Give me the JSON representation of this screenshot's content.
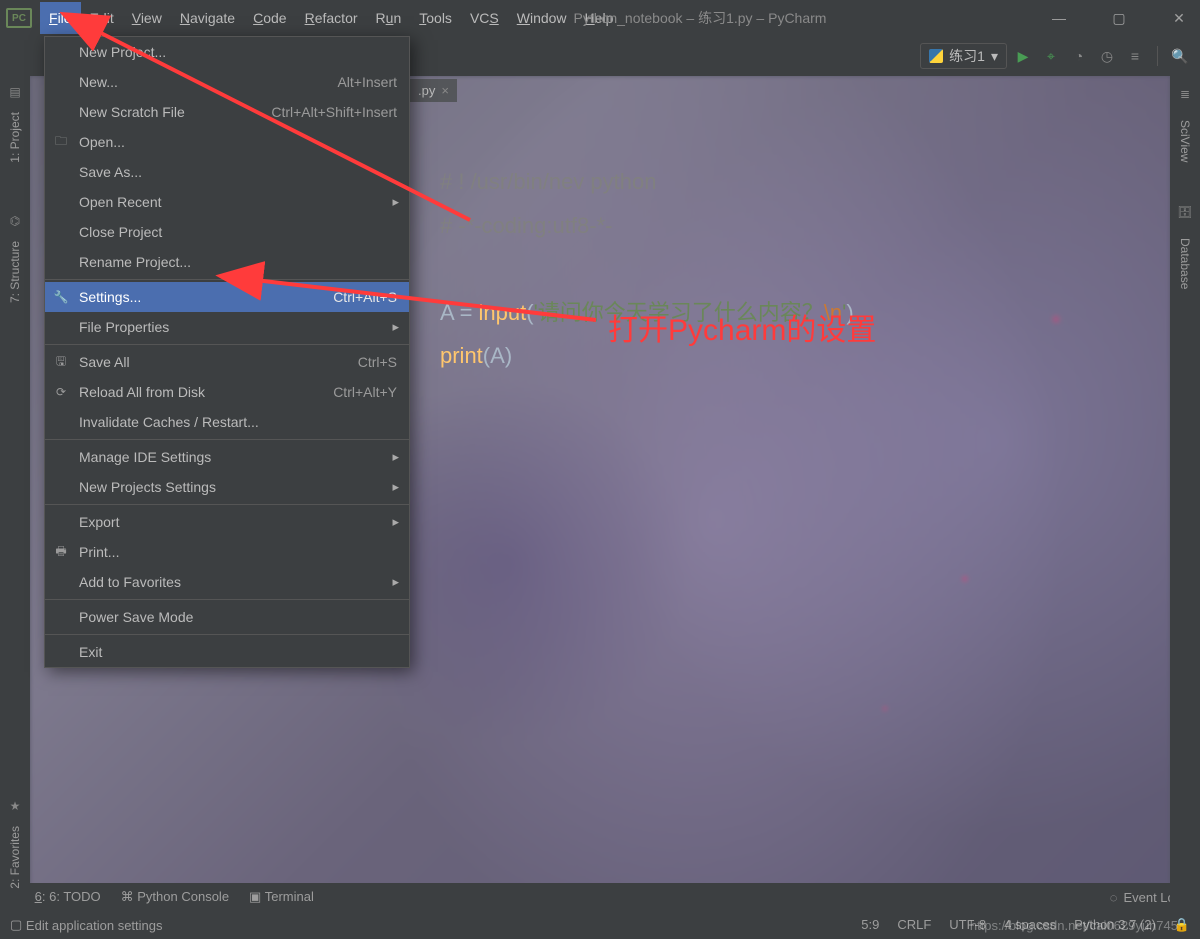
{
  "title": "Python_notebook – 练习1.py – PyCharm",
  "menubar": [
    "File",
    "Edit",
    "View",
    "Navigate",
    "Code",
    "Refactor",
    "Run",
    "Tools",
    "VCS",
    "Window",
    "Help"
  ],
  "window_controls": {
    "min": "—",
    "max": "▢",
    "close": "✕"
  },
  "toolbar": {
    "run_config_label": "练习1",
    "run_config_caret": "▾"
  },
  "left_tools": {
    "project": "1: Project",
    "structure": "7: Structure",
    "favorites": "2: Favorites"
  },
  "right_tools": {
    "sciview": "SciView",
    "database": "Database"
  },
  "tab": {
    "label": ".py",
    "close": "×"
  },
  "code": {
    "l1_a": "# ! /usr/bin/nev python",
    "l2_a": "# -*-coding:utf8-*-",
    "l3_v": "A",
    "l3_eq": " = ",
    "l3_fn": "input",
    "l3_p1": "(",
    "l3_s1": "'",
    "l3_s2": "请问你今天学习了什么内容？",
    "l3_esc": "\\n",
    "l3_s3": "'",
    "l3_p2": ")",
    "l4_fn": "print",
    "l4_p1": "(",
    "l4_v": "A",
    "l4_p2": ")"
  },
  "dropdown": [
    {
      "label": "New Project..."
    },
    {
      "label": "New...",
      "shortcut": "Alt+Insert"
    },
    {
      "label": "New Scratch File",
      "shortcut": "Ctrl+Alt+Shift+Insert"
    },
    {
      "label": "Open...",
      "icon": "folder"
    },
    {
      "label": "Save As..."
    },
    {
      "label": "Open Recent",
      "sub": true
    },
    {
      "label": "Close Project"
    },
    {
      "label": "Rename Project..."
    },
    {
      "sep": true
    },
    {
      "label": "Settings...",
      "shortcut": "Ctrl+Alt+S",
      "icon": "wrench",
      "hl": true
    },
    {
      "label": "File Properties",
      "sub": true
    },
    {
      "sep": true
    },
    {
      "label": "Save All",
      "shortcut": "Ctrl+S",
      "icon": "save"
    },
    {
      "label": "Reload All from Disk",
      "shortcut": "Ctrl+Alt+Y",
      "icon": "reload"
    },
    {
      "label": "Invalidate Caches / Restart..."
    },
    {
      "sep": true
    },
    {
      "label": "Manage IDE Settings",
      "sub": true
    },
    {
      "label": "New Projects Settings",
      "sub": true
    },
    {
      "sep": true
    },
    {
      "label": "Export",
      "sub": true
    },
    {
      "label": "Print...",
      "icon": "print"
    },
    {
      "label": "Add to Favorites",
      "sub": true
    },
    {
      "sep": true
    },
    {
      "label": "Power Save Mode"
    },
    {
      "sep": true
    },
    {
      "label": "Exit"
    }
  ],
  "annotation": {
    "text": "打开Pycharm的设置"
  },
  "bottom": {
    "todo": "6: TODO",
    "pyconsole": "Python Console",
    "terminal": "Terminal",
    "eventlog": "Event Log"
  },
  "status": {
    "hint": "Edit application settings",
    "pos": "5:9",
    "eol": "CRLF",
    "enc": "UTF-8",
    "spaces": "4 spaces",
    "interp": "Python 3.7 (2)"
  },
  "watermark": "https://blog.csdn.net/cai0629yun745"
}
